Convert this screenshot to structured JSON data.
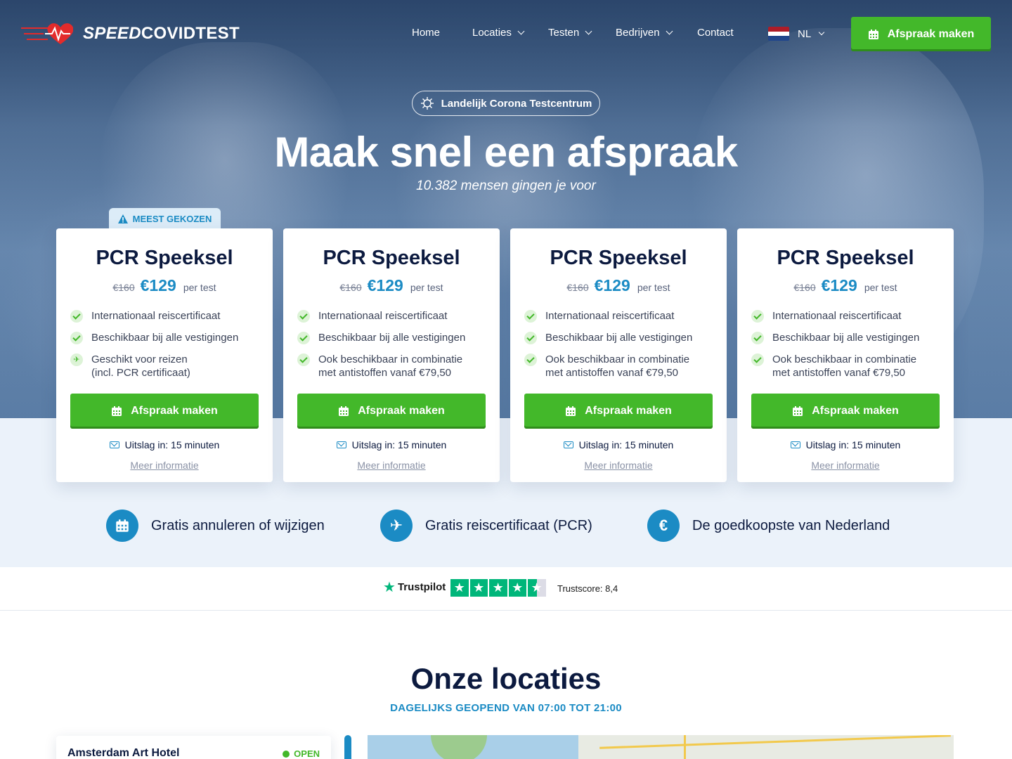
{
  "brand": {
    "name_italic": "SPEED",
    "name_bold": "COVIDTEST"
  },
  "nav": {
    "items": [
      {
        "label": "Home",
        "dropdown": false
      },
      {
        "label": "Locaties",
        "dropdown": true
      },
      {
        "label": "Testen",
        "dropdown": true
      },
      {
        "label": "Bedrijven",
        "dropdown": true
      },
      {
        "label": "Contact",
        "dropdown": false
      }
    ],
    "language": "NL",
    "cta": "Afspraak maken"
  },
  "hero": {
    "pill": "Landelijk Corona Testcentrum",
    "title": "Maak snel een afspraak",
    "subtitle": "10.382 mensen gingen je voor"
  },
  "badge": "MEEST GEKOZEN",
  "cards": [
    {
      "title": "PCR Speeksel",
      "old_price": "€160",
      "price": "€129",
      "per": "per test",
      "features": [
        {
          "icon": "check",
          "text": "Internationaal reiscertificaat"
        },
        {
          "icon": "check",
          "text": "Beschikbaar bij alle vestigingen"
        },
        {
          "icon": "plane",
          "text": "Geschikt voor reizen",
          "text2": "(incl. PCR certificaat)"
        }
      ],
      "button": "Afspraak maken",
      "result": "Uitslag in: 15 minuten",
      "more": "Meer informatie"
    },
    {
      "title": "PCR Speeksel",
      "old_price": "€160",
      "price": "€129",
      "per": "per test",
      "features": [
        {
          "icon": "check",
          "text": "Internationaal reiscertificaat"
        },
        {
          "icon": "check",
          "text": "Beschikbaar bij alle vestigingen"
        },
        {
          "icon": "check",
          "text": "Ook beschikbaar in combinatie",
          "text2": "met antistoffen vanaf €79,50"
        }
      ],
      "button": "Afspraak maken",
      "result": "Uitslag in: 15 minuten",
      "more": "Meer informatie"
    },
    {
      "title": "PCR Speeksel",
      "old_price": "€160",
      "price": "€129",
      "per": "per test",
      "features": [
        {
          "icon": "check",
          "text": "Internationaal reiscertificaat"
        },
        {
          "icon": "check",
          "text": "Beschikbaar bij alle vestigingen"
        },
        {
          "icon": "check",
          "text": "Ook beschikbaar in combinatie",
          "text2": "met antistoffen vanaf €79,50"
        }
      ],
      "button": "Afspraak maken",
      "result": "Uitslag in: 15 minuten",
      "more": "Meer informatie"
    },
    {
      "title": "PCR Speeksel",
      "old_price": "€160",
      "price": "€129",
      "per": "per test",
      "features": [
        {
          "icon": "check",
          "text": "Internationaal reiscertificaat"
        },
        {
          "icon": "check",
          "text": "Beschikbaar bij alle vestigingen"
        },
        {
          "icon": "check",
          "text": "Ook beschikbaar in combinatie",
          "text2": "met antistoffen vanaf €79,50"
        }
      ],
      "button": "Afspraak maken",
      "result": "Uitslag in: 15 minuten",
      "more": "Meer informatie"
    }
  ],
  "usps": [
    {
      "icon": "calendar-icon",
      "text": "Gratis annuleren of wijzigen"
    },
    {
      "icon": "plane-icon",
      "text": "Gratis reiscertificaat (PCR)"
    },
    {
      "icon": "euro-icon",
      "text": "De goedkoopste van Nederland",
      "glyph": "€"
    }
  ],
  "trustpilot": {
    "brand": "Trustpilot",
    "score_label": "Trustscore: 8,4",
    "stars": 4.5
  },
  "locations": {
    "title": "Onze locaties",
    "subtitle": "DAGELIJKS GEOPEND VAN 07:00 TOT 21:00",
    "first": {
      "name": "Amsterdam Art Hotel",
      "status": "OPEN"
    }
  },
  "colors": {
    "green": "#43b82a",
    "blue": "#1b8bc4",
    "navy": "#0c1a3f",
    "band": "#ebf2fa",
    "trustpilot": "#00b67a"
  }
}
